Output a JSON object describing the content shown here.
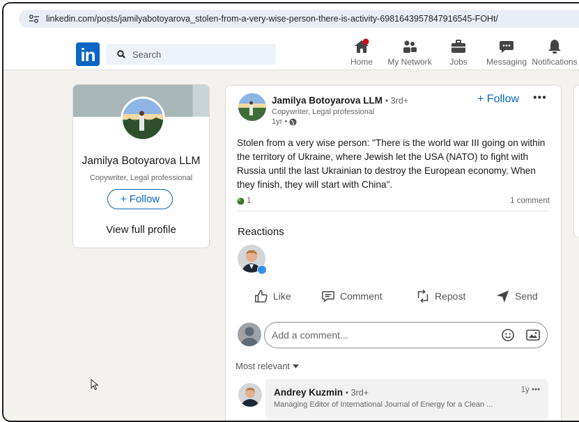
{
  "browser": {
    "url": "linkedin.com/posts/jamilyabotoyarova_stolen-from-a-very-wise-person-there-is-activity-6981643957847916545-FOHt/"
  },
  "nav": {
    "logo": "in",
    "search_placeholder": "Search",
    "items": [
      {
        "label": "Home",
        "icon": "home-icon"
      },
      {
        "label": "My Network",
        "icon": "network-icon"
      },
      {
        "label": "Jobs",
        "icon": "briefcase-icon"
      },
      {
        "label": "Messaging",
        "icon": "chat-icon"
      },
      {
        "label": "Notifications",
        "icon": "bell-icon"
      }
    ],
    "accent": "#0a66c2",
    "notification_dot": "#cc1016"
  },
  "profile": {
    "name": "Jamilya Botoyarova LLM",
    "headline": "Copywriter, Legal professional",
    "follow_label": "+ Follow",
    "view_profile_label": "View full profile"
  },
  "post": {
    "author": "Jamilya Botoyarova LLM",
    "degree": "• 3rd+",
    "headline": "Copywriter, Legal professional",
    "time": "1yr •",
    "follow_label": "+ Follow",
    "more_label": "•••",
    "text": "Stolen from a very wise person: \"There is the world war III going on within the territory of Ukraine, where Jewish let the USA (NATO) to fight with Russia until the last Ukrainian to destroy the European economy. When they finish, they will start with China\".",
    "reaction_count": "1",
    "comment_count": "1 comment",
    "reactions_title": "Reactions",
    "actions": {
      "like": "Like",
      "comment": "Comment",
      "repost": "Repost",
      "send": "Send"
    },
    "comment_placeholder": "Add a comment...",
    "sort_label": "Most relevant"
  },
  "comment": {
    "author": "Andrey Kuzmin",
    "degree": "• 3rd+",
    "headline": "Managing Editor of International Journal of Energy for a Clean ...",
    "time": "1y •••"
  }
}
